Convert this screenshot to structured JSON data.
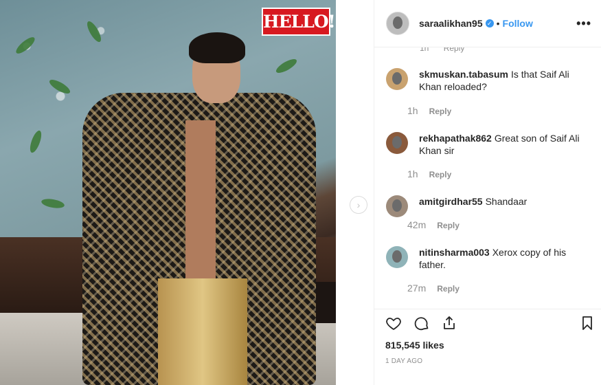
{
  "post": {
    "magazine_logo": "HELLO!",
    "likes_text": "815,545 likes",
    "time_ago": "1 DAY AGO"
  },
  "header": {
    "username": "saraalikhan95",
    "dot": "•",
    "follow_label": "Follow",
    "more_label": "•••",
    "verified_glyph": "✓"
  },
  "peek": {
    "time": "1h",
    "reply": "Reply"
  },
  "comments": [
    {
      "user": "skmuskan.tabasum",
      "text": "Is that Saif Ali Khan reloaded?",
      "time": "1h",
      "reply": "Reply"
    },
    {
      "user": "rekhapathak862",
      "text": "Great son of Saif Ali Khan sir",
      "time": "1h",
      "reply": "Reply"
    },
    {
      "user": "amitgirdhar55",
      "text": "Shandaar",
      "time": "42m",
      "reply": "Reply"
    },
    {
      "user": "nitinsharma003",
      "text": "Xerox copy of his father.",
      "time": "27m",
      "reply": "Reply"
    }
  ],
  "icons": {
    "like": "heart-icon",
    "comment": "comment-bubble-icon",
    "share": "share-icon",
    "save": "bookmark-icon",
    "next": "chevron-right-icon",
    "more": "more-options-icon"
  },
  "colors": {
    "accent": "#3897f0",
    "text": "#262626",
    "muted": "#8e8e8e",
    "logo_red": "#d71920"
  }
}
